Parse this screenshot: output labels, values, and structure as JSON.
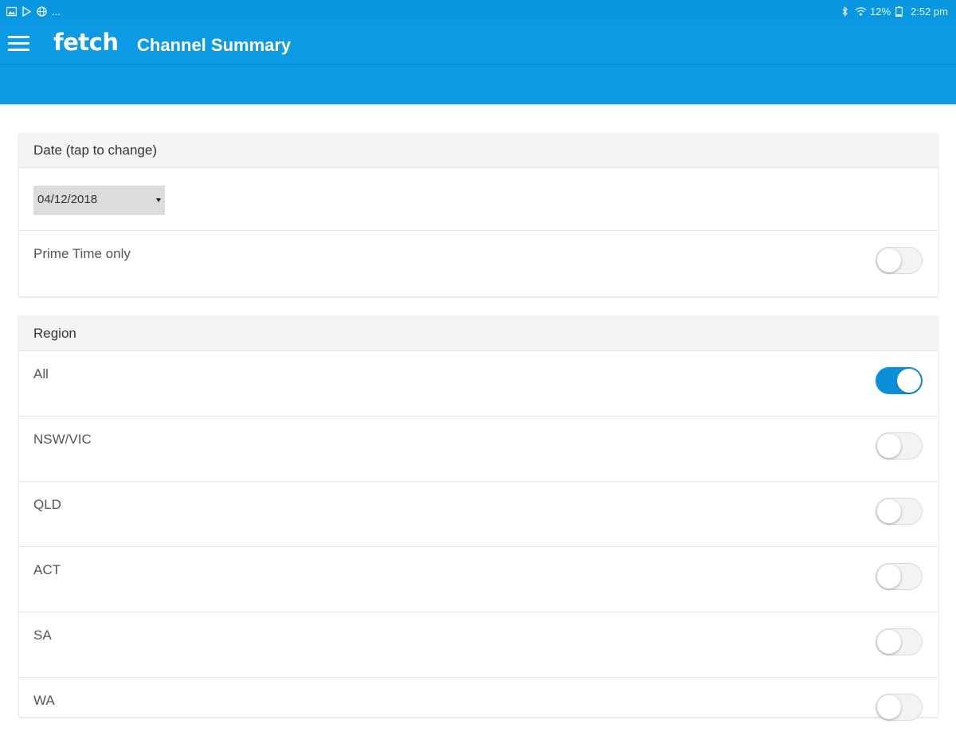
{
  "status_bar": {
    "left_icons": [
      "image-icon",
      "play-store-icon",
      "globe-icon"
    ],
    "ellipsis": "...",
    "right_icons": [
      "bluetooth-icon",
      "wifi-icon"
    ],
    "battery": "12%",
    "time": "2:52 pm"
  },
  "app_bar": {
    "logo": "fetch",
    "title": "Channel Summary",
    "menu_icon": "hamburger-menu-icon"
  },
  "colors": {
    "accent": "#0b9ae3",
    "toggle_on": "#0b8fd8"
  },
  "date_section": {
    "header": "Date (tap to change)",
    "selected_date": "04/12/2018",
    "prime_time": {
      "label": "Prime Time only",
      "on": false
    }
  },
  "region_section": {
    "header": "Region",
    "items": [
      {
        "label": "All",
        "on": true
      },
      {
        "label": "NSW/VIC",
        "on": false
      },
      {
        "label": "QLD",
        "on": false
      },
      {
        "label": "ACT",
        "on": false
      },
      {
        "label": "SA",
        "on": false
      },
      {
        "label": "WA",
        "on": false
      }
    ]
  }
}
